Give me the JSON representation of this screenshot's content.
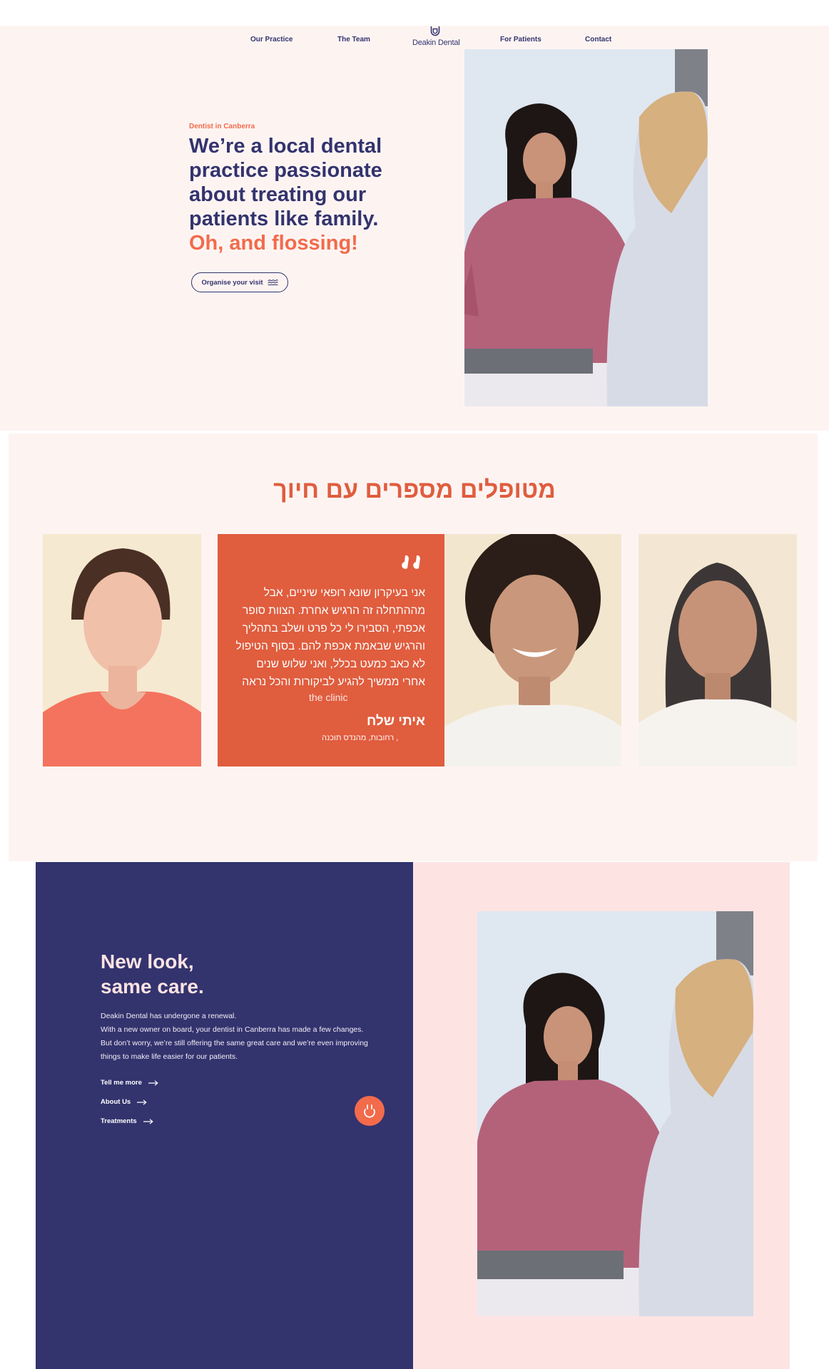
{
  "nav": {
    "items": [
      "Our Practice",
      "The Team",
      "For Patients",
      "Contact"
    ],
    "logo_text": "Deakin Dental"
  },
  "hero": {
    "eyebrow": "Dentist in Canberra",
    "headline": "We’re a local dental practice passionate about treating our patients like family.",
    "accent": "Oh, and flossing!",
    "cta_label": "Organise your visit"
  },
  "testimonials": {
    "title": "מטופלים מספרים עם חיוך",
    "quote": "אני בעיקרון שונא רופאי שיניים, אבל מההתחלה זה הרגיש אחרת. הצוות סופר אכפתי, הסבירו לי כל פרט ושלב בתהליך והרגיש שבאמת אכפת להם. בסוף הטיפול לא כאב כמעט בכלל, ואני שלוש שנים אחרי ממשיך להגיע לביקורות והכל נראה",
    "quote_en": "the clinic",
    "name": "איתי שלח",
    "role": ", רחובות, מהנדס תוכנה"
  },
  "renewal": {
    "title_line1": "New look,",
    "title_line2": "same care.",
    "body_line1": "Deakin Dental has undergone a renewal.",
    "body_line2": "With a new owner on board, your  dentist in Canberra  has made a few changes. But don’t worry, we’re still offering the same great care and we’re even improving things to make life easier for our patients.",
    "links": [
      "Tell me more",
      "About Us",
      "Treatments"
    ]
  },
  "colors": {
    "navy": "#33336e",
    "coral": "#f26b4b",
    "quote_card": "#e05d3e",
    "hero_bg": "#fdf4f2",
    "pink_panel": "#fde4e3"
  },
  "icons": [
    "dental-shield-icon",
    "wave-icon",
    "quote-icon",
    "arrow-right-icon",
    "smile-icon"
  ]
}
